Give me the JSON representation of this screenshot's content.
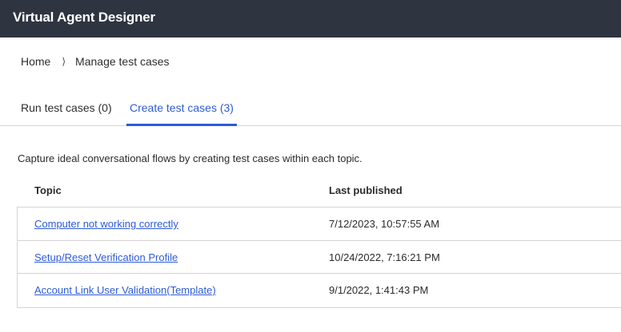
{
  "header": {
    "title": "Virtual Agent Designer"
  },
  "breadcrumb": {
    "home": "Home",
    "separator": "⟩",
    "current": "Manage test cases"
  },
  "tabs": [
    {
      "label": "Run test cases (0)",
      "active": false
    },
    {
      "label": "Create test cases (3)",
      "active": true
    }
  ],
  "description": "Capture ideal conversational flows by creating test cases within each topic.",
  "table": {
    "columns": [
      "Topic",
      "Last published"
    ],
    "rows": [
      {
        "topic": "Computer not working correctly",
        "last_published": "7/12/2023, 10:57:55 AM"
      },
      {
        "topic": "Setup/Reset Verification Profile",
        "last_published": "10/24/2022, 7:16:21 PM"
      },
      {
        "topic": "Account Link User Validation(Template)",
        "last_published": "9/1/2022, 1:41:43 PM"
      }
    ]
  },
  "colors": {
    "header_bg": "#2e3440",
    "accent": "#2d5bd6"
  }
}
